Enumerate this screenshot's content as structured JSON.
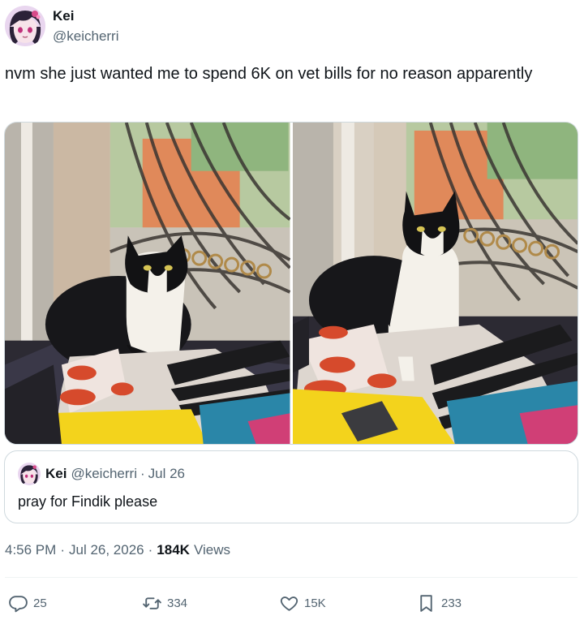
{
  "author": {
    "display_name": "Kei",
    "handle": "@keicherri"
  },
  "tweet": {
    "text": "nvm she just wanted me to spend 6K on vet bills for no reason apparently"
  },
  "quoted_tweet": {
    "display_name": "Kei",
    "handle": "@keicherri",
    "separator": "·",
    "date": "Jul 26",
    "text": "pray for Findik please"
  },
  "meta": {
    "time": "4:56 PM",
    "separator": "·",
    "date": "Jul 26, 2026",
    "views_count": "184K",
    "views_label": "Views"
  },
  "actions": {
    "replies": "25",
    "retweets": "334",
    "likes": "15K",
    "bookmarks": "233"
  },
  "icons": {
    "reply": "reply-icon",
    "retweet": "retweet-icon",
    "like": "heart-icon",
    "bookmark": "bookmark-icon"
  },
  "colors": {
    "text_primary": "#0f1419",
    "text_secondary": "#536471",
    "border": "#cfd9de",
    "divider": "#eff3f4"
  }
}
